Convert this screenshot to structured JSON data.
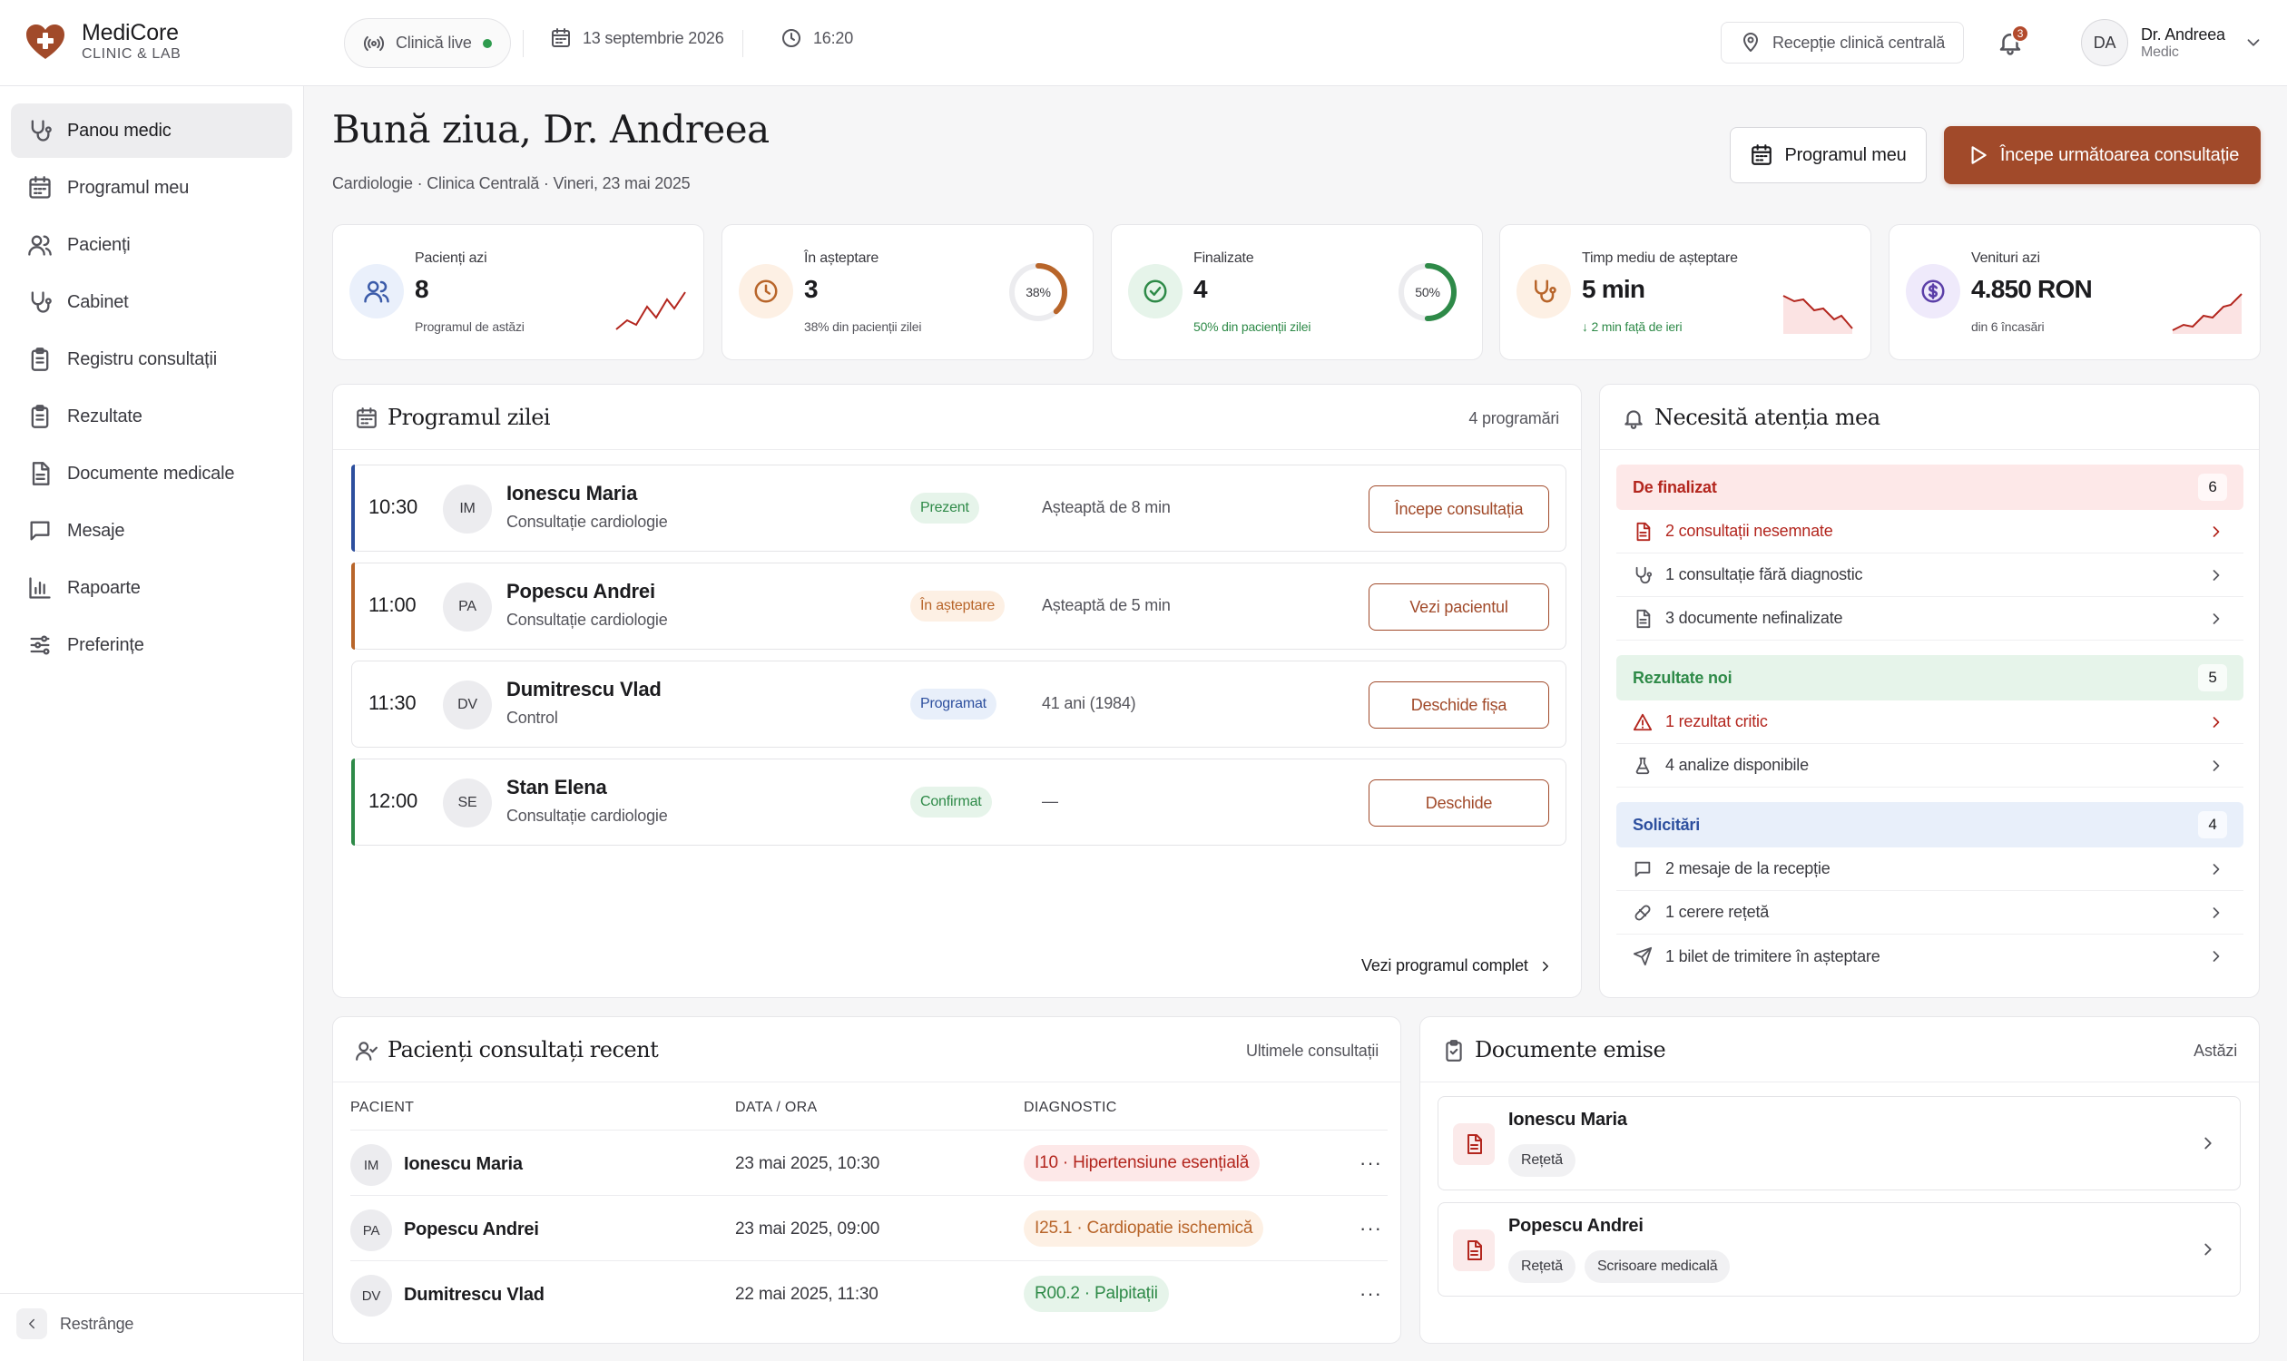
{
  "brand": {
    "name": "MediCore",
    "sub": "CLINIC & LAB"
  },
  "topbar": {
    "live_label": "Clinică live",
    "date": "13 septembrie 2026",
    "time": "16:20",
    "location": "Recepție clinică centrală",
    "notifications_count": "3",
    "user_initials": "DA",
    "user_name": "Dr. Andreea",
    "user_role": "Medic"
  },
  "sidebar": {
    "items": [
      {
        "label": "Panou medic",
        "icon": "stethoscope-icon",
        "active": true
      },
      {
        "label": "Programul meu",
        "icon": "calendar-icon"
      },
      {
        "label": "Pacienți",
        "icon": "users-icon"
      },
      {
        "label": "Cabinet",
        "icon": "stethoscope-icon"
      },
      {
        "label": "Registru consultații",
        "icon": "clipboard-icon"
      },
      {
        "label": "Rezultate",
        "icon": "clipboard-icon"
      },
      {
        "label": "Documente medicale",
        "icon": "document-icon"
      },
      {
        "label": "Mesaje",
        "icon": "message-icon"
      },
      {
        "label": "Rapoarte",
        "icon": "bar-chart-icon"
      },
      {
        "label": "Preferințe",
        "icon": "sliders-icon"
      }
    ],
    "collapse_label": "Restrânge"
  },
  "header": {
    "greeting": "Bună ziua, Dr. Andreea",
    "subtitle": "Cardiologie · Clinica Centrală · Vineri, 23 mai 2025",
    "schedule_button": "Programul meu",
    "start_button": "Începe următoarea consultație"
  },
  "kpis": [
    {
      "label": "Pacienți azi",
      "value": "8",
      "note": "Programul de astăzi",
      "icon": "users-icon",
      "accent": "#3b5ba9"
    },
    {
      "label": "În așteptare",
      "value": "3",
      "note": "38% din pacienții zilei",
      "icon": "clock-icon",
      "accent": "#b8652a",
      "ring_text": "38%",
      "ring_value": 0.38
    },
    {
      "label": "Finalizate",
      "value": "4",
      "note": "50% din pacienții zilei",
      "icon": "check-circle-icon",
      "accent": "#2e8a48",
      "ring_text": "50%",
      "ring_value": 0.5
    },
    {
      "label": "Timp mediu de așteptare",
      "value": "5 min",
      "note": "↓ 2 min față de ieri",
      "icon": "stethoscope-icon",
      "accent": "#b8652a"
    },
    {
      "label": "Venituri azi",
      "value": "4.850 RON",
      "note": "din 6 încasări",
      "icon": "dollar-icon",
      "accent": "#5b3fa8"
    }
  ],
  "schedule": {
    "title": "Programul zilei",
    "count": "4 programări",
    "appointments": [
      {
        "time": "10:30",
        "initials": "IM",
        "name": "Ionescu Maria",
        "type": "Consultație cardiologie",
        "status": "Prezent",
        "status_color": "#2e8a48",
        "status_bg": "#e6f4ea",
        "info": "Așteaptă de 8 min",
        "action": "Începe consultația",
        "accent": "#2d4f9e"
      },
      {
        "time": "11:00",
        "initials": "PA",
        "name": "Popescu Andrei",
        "type": "Consultație cardiologie",
        "status": "În așteptare",
        "status_color": "#b8652a",
        "status_bg": "#fdf0e4",
        "info": "Așteaptă de 5 min",
        "action": "Vezi pacientul",
        "accent": "#b8652a"
      },
      {
        "time": "11:30",
        "initials": "DV",
        "name": "Dumitrescu Vlad",
        "type": "Control",
        "status": "Programat",
        "status_color": "#2d4f9e",
        "status_bg": "#e8effa",
        "info": "41 ani (1984)",
        "action": "Deschide fișa",
        "accent": ""
      },
      {
        "time": "12:00",
        "initials": "SE",
        "name": "Stan Elena",
        "type": "Consultație cardiologie",
        "status": "Confirmat",
        "status_color": "#2e8a48",
        "status_bg": "#e6f4ea",
        "info": "—",
        "action": "Deschide",
        "accent": "#2e8a48"
      }
    ],
    "view_all": "Vezi programul complet"
  },
  "attention": {
    "title": "Necesită atenția mea",
    "groups": [
      {
        "title": "De finalizat",
        "count": "6",
        "color": "#b3261e",
        "bg": "#fde8e8",
        "rows": [
          {
            "label": "2 consultații nesemnate",
            "icon": "document-icon",
            "alert": true
          },
          {
            "label": "1 consultație fără diagnostic",
            "icon": "stethoscope-icon",
            "alert": false
          },
          {
            "label": "3 documente nefinalizate",
            "icon": "document-icon",
            "alert": false
          }
        ]
      },
      {
        "title": "Rezultate noi",
        "count": "5",
        "color": "#2e8a48",
        "bg": "#e6f4ea",
        "rows": [
          {
            "label": "1 rezultat critic",
            "icon": "warning-icon",
            "alert": true
          },
          {
            "label": "4 analize disponibile",
            "icon": "flask-icon",
            "alert": false
          }
        ]
      },
      {
        "title": "Solicitări",
        "count": "4",
        "color": "#2d4f9e",
        "bg": "#e8effa",
        "rows": [
          {
            "label": "2 mesaje de la recepție",
            "icon": "message-icon",
            "alert": false
          },
          {
            "label": "1 cerere rețetă",
            "icon": "pill-icon",
            "alert": false
          },
          {
            "label": "1 bilet de trimitere în așteptare",
            "icon": "send-icon",
            "alert": false
          }
        ]
      }
    ]
  },
  "recent": {
    "title": "Pacienți consultați recent",
    "right": "Ultimele consultații",
    "columns": [
      "PACIENT",
      "DATA / ORA",
      "DIAGNOSTIC"
    ],
    "rows": [
      {
        "initials": "IM",
        "name": "Ionescu Maria",
        "date": "23 mai 2025, 10:30",
        "diagnosis": "I10 · Hipertensiune esențială",
        "color": "#b3261e",
        "bg": "#fde8e8"
      },
      {
        "initials": "PA",
        "name": "Popescu Andrei",
        "date": "23 mai 2025, 09:00",
        "diagnosis": "I25.1 · Cardiopatie ischemică",
        "color": "#b8652a",
        "bg": "#fdf0e4"
      },
      {
        "initials": "DV",
        "name": "Dumitrescu Vlad",
        "date": "22 mai 2025, 11:30",
        "diagnosis": "R00.2 · Palpitații",
        "color": "#2e8a48",
        "bg": "#e6f4ea"
      }
    ]
  },
  "documents": {
    "title": "Documente emise",
    "right": "Astăzi",
    "items": [
      {
        "name": "Ionescu Maria",
        "tags": [
          "Rețetă"
        ]
      },
      {
        "name": "Popescu Andrei",
        "tags": [
          "Rețetă",
          "Scrisoare medicală"
        ]
      }
    ]
  }
}
